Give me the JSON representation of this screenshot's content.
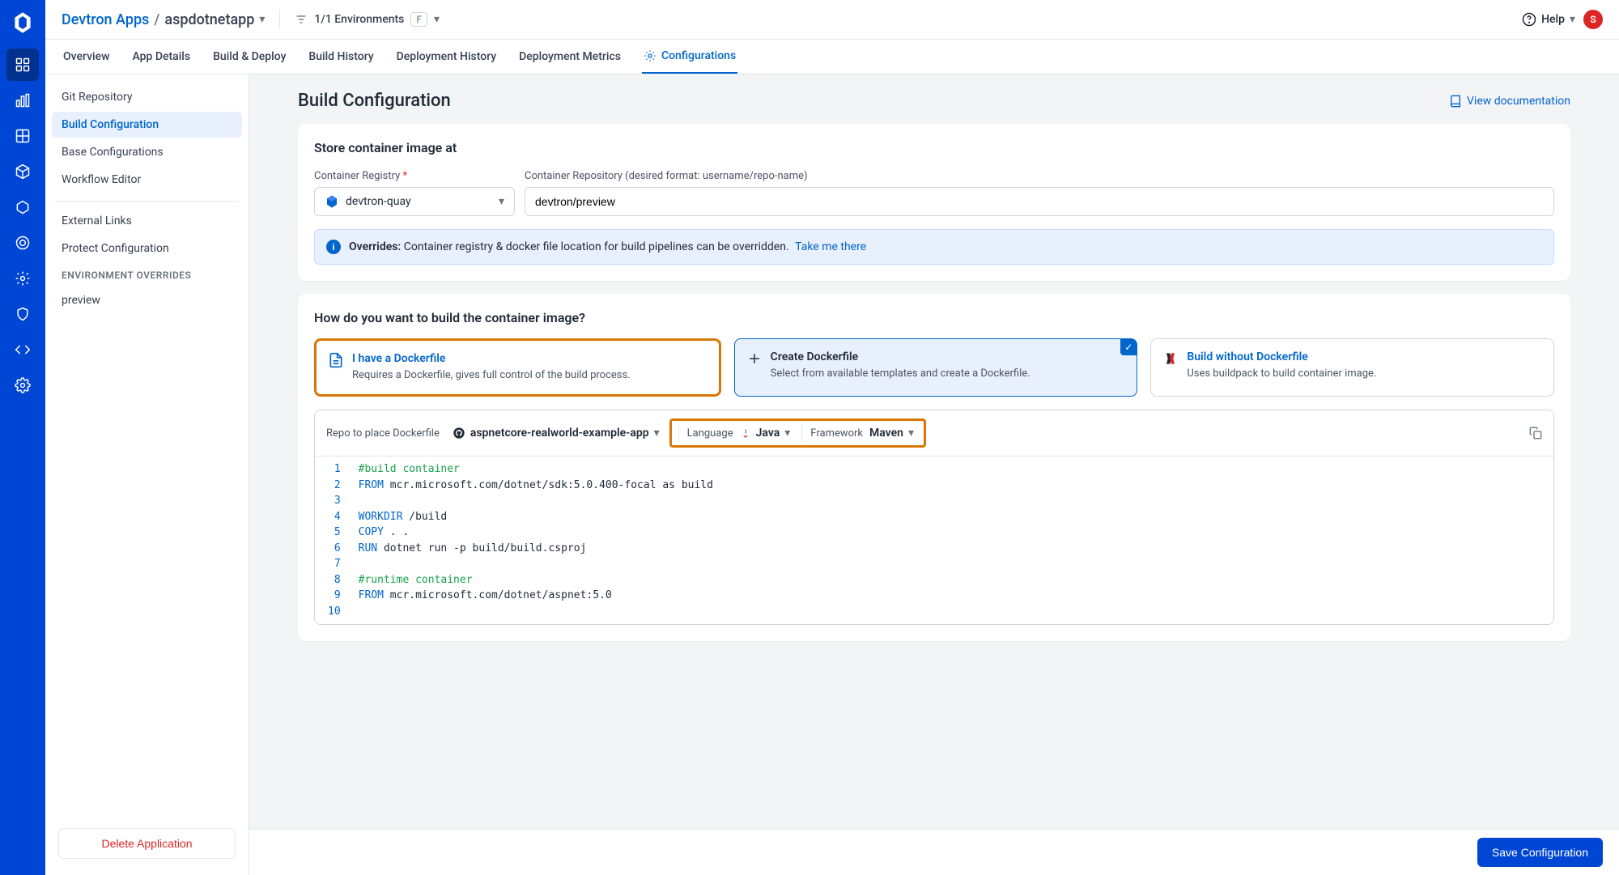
{
  "breadcrumb": {
    "root": "Devtron Apps",
    "current": "aspdotnetapp"
  },
  "env_filter": {
    "text": "1/1 Environments",
    "shortcut": "F"
  },
  "help": {
    "label": "Help"
  },
  "avatar": "S",
  "tabs": [
    "Overview",
    "App Details",
    "Build & Deploy",
    "Build History",
    "Deployment History",
    "Deployment Metrics",
    "Configurations"
  ],
  "active_tab": 6,
  "sidebar": {
    "items": [
      "Git Repository",
      "Build Configuration",
      "Base Configurations",
      "Workflow Editor"
    ],
    "active": 1,
    "secondary": [
      "External Links",
      "Protect Configuration"
    ],
    "overrides_heading": "ENVIRONMENT OVERRIDES",
    "overrides": [
      "preview"
    ],
    "delete_btn": "Delete Application"
  },
  "page": {
    "title": "Build Configuration",
    "doc_link": "View documentation"
  },
  "store": {
    "heading": "Store container image at",
    "registry_label": "Container Registry",
    "registry_value": "devtron-quay",
    "repo_label": "Container Repository (desired format: username/repo-name)",
    "repo_value": "devtron/preview"
  },
  "banner": {
    "bold": "Overrides:",
    "text": "Container registry & docker file location for build pipelines can be overridden.",
    "link": "Take me there"
  },
  "build": {
    "question": "How do you want to build the container image?",
    "options": [
      {
        "title": "I have a Dockerfile",
        "desc": "Requires a Dockerfile, gives full control of the build process."
      },
      {
        "title": "Create Dockerfile",
        "desc": "Select from available templates and create a Dockerfile."
      },
      {
        "title": "Build without Dockerfile",
        "desc": "Uses buildpack to build container image."
      }
    ]
  },
  "editor": {
    "repo_label": "Repo to place Dockerfile",
    "repo_value": "aspnetcore-realworld-example-app",
    "lang_label": "Language",
    "lang_value": "Java",
    "fw_label": "Framework",
    "fw_value": "Maven",
    "lines": [
      {
        "t": "comment",
        "text": "#build container"
      },
      {
        "t": "from",
        "kw": "FROM",
        "rest": " mcr.microsoft.com/dotnet/sdk:5.0.400-focal as build"
      },
      {
        "t": "blank",
        "text": ""
      },
      {
        "t": "kw",
        "kw": "WORKDIR",
        "rest": " /build"
      },
      {
        "t": "kw",
        "kw": "COPY",
        "rest": " . ."
      },
      {
        "t": "kw",
        "kw": "RUN",
        "rest": " dotnet run -p build/build.csproj"
      },
      {
        "t": "blank",
        "text": ""
      },
      {
        "t": "comment",
        "text": "#runtime container"
      },
      {
        "t": "from",
        "kw": "FROM",
        "rest": " mcr.microsoft.com/dotnet/aspnet:5.0"
      },
      {
        "t": "blank",
        "text": ""
      }
    ]
  },
  "footer": {
    "save": "Save Configuration"
  }
}
